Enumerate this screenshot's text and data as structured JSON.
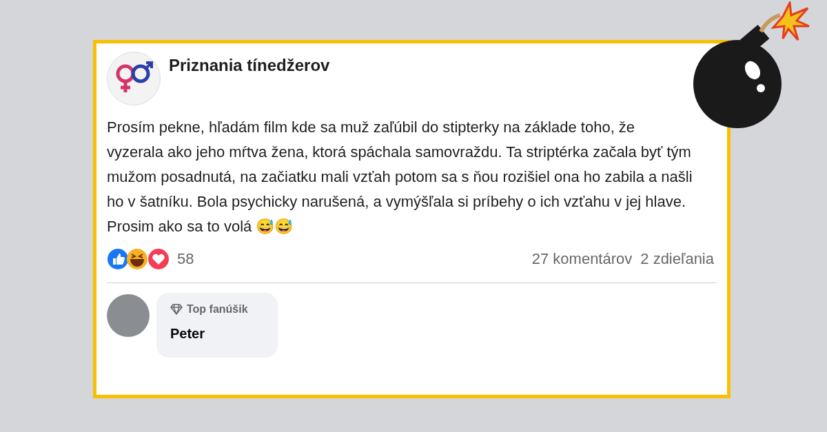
{
  "post": {
    "author": "Priznania tínedžerov",
    "text": "Prosím pekne, hľadám film kde sa muž zaľúbil do stipterky na základe toho, že vyzerala ako jeho mŕtva žena, ktorá spáchala samovraždu. Ta striptérka začala byť tým mužom posadnutá, na začiatku mali vzťah potom sa s ňou rozišiel ona ho zabila a našli ho v šatníku. Bola psychicky narušená, a vymýšľala si príbehy o ich vzťahu v jej hlave. Prosim ako sa to volá 😅😅",
    "reaction_count": "58",
    "comments": "27 komentárov",
    "shares": "2 zdieľania"
  },
  "comment": {
    "badge": "Top fanúšik",
    "author": "Peter"
  }
}
